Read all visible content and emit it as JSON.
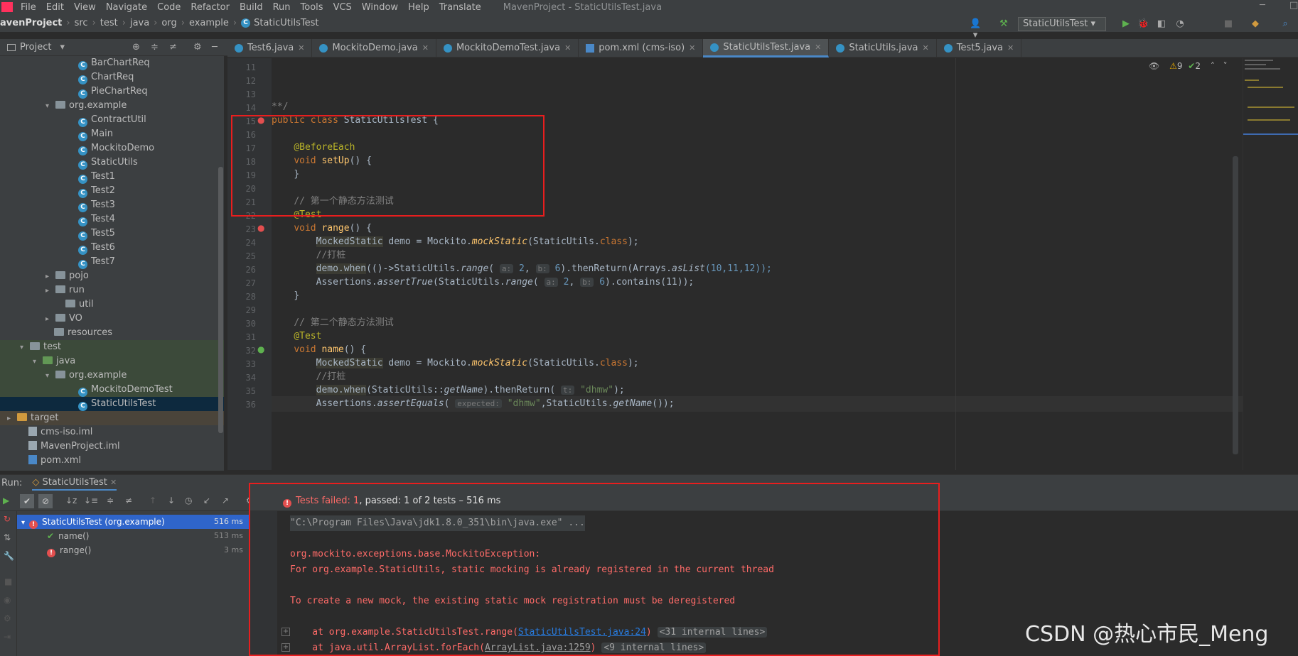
{
  "menu": {
    "items": [
      "File",
      "Edit",
      "View",
      "Navigate",
      "Code",
      "Refactor",
      "Build",
      "Run",
      "Tools",
      "VCS",
      "Window",
      "Help",
      "Translate"
    ],
    "window_title": "MavenProject - StaticUtilsTest.java"
  },
  "breadcrumb": [
    "avenProject",
    "src",
    "test",
    "java",
    "org",
    "example",
    "StaticUtilsTest"
  ],
  "toolbar": {
    "run_config": "StaticUtilsTest"
  },
  "project_panel": {
    "title": "Project"
  },
  "tree": [
    {
      "label": "BarChartReq",
      "indent": 110,
      "icon": "class"
    },
    {
      "label": "ChartReq",
      "indent": 110,
      "icon": "class"
    },
    {
      "label": "PieChartReq",
      "indent": 110,
      "icon": "class"
    },
    {
      "label": "org.example",
      "indent": 78,
      "icon": "package",
      "arrow": "v"
    },
    {
      "label": "ContractUtil",
      "indent": 110,
      "icon": "class"
    },
    {
      "label": "Main",
      "indent": 110,
      "icon": "class"
    },
    {
      "label": "MockitoDemo",
      "indent": 110,
      "icon": "class"
    },
    {
      "label": "StaticUtils",
      "indent": 110,
      "icon": "class"
    },
    {
      "label": "Test1",
      "indent": 110,
      "icon": "class"
    },
    {
      "label": "Test2",
      "indent": 110,
      "icon": "class"
    },
    {
      "label": "Test3",
      "indent": 110,
      "icon": "class"
    },
    {
      "label": "Test4",
      "indent": 110,
      "icon": "class"
    },
    {
      "label": "Test5",
      "indent": 110,
      "icon": "class"
    },
    {
      "label": "Test6",
      "indent": 110,
      "icon": "class"
    },
    {
      "label": "Test7",
      "indent": 110,
      "icon": "class"
    },
    {
      "label": "pojo",
      "indent": 78,
      "icon": "folder",
      "arrow": ">"
    },
    {
      "label": "run",
      "indent": 78,
      "icon": "folder",
      "arrow": ">"
    },
    {
      "label": "util",
      "indent": 92,
      "icon": "folder"
    },
    {
      "label": "VO",
      "indent": 78,
      "icon": "folder",
      "arrow": ">"
    },
    {
      "label": "resources",
      "indent": 76,
      "icon": "folder"
    },
    {
      "label": "test",
      "indent": 42,
      "icon": "folder",
      "arrow": "v"
    },
    {
      "label": "java",
      "indent": 60,
      "icon": "folder-green",
      "arrow": "v"
    },
    {
      "label": "org.example",
      "indent": 78,
      "icon": "package",
      "arrow": "v"
    },
    {
      "label": "MockitoDemoTest",
      "indent": 110,
      "icon": "class"
    },
    {
      "label": "StaticUtilsTest",
      "indent": 110,
      "icon": "class",
      "selected": true
    },
    {
      "label": "target",
      "indent": 24,
      "icon": "folder-orange",
      "arrow": ">"
    },
    {
      "label": "cms-iso.iml",
      "indent": 40,
      "icon": "file"
    },
    {
      "label": "MavenProject.iml",
      "indent": 40,
      "icon": "file"
    },
    {
      "label": "pom.xml",
      "indent": 40,
      "icon": "maven"
    }
  ],
  "tabs": [
    {
      "label": "Test6.java"
    },
    {
      "label": "MockitoDemo.java"
    },
    {
      "label": "MockitoDemoTest.java"
    },
    {
      "label": "pom.xml (cms-iso)"
    },
    {
      "label": "StaticUtilsTest.java",
      "active": true
    },
    {
      "label": "StaticUtils.java"
    },
    {
      "label": "Test5.java"
    }
  ],
  "editor": {
    "inspections": {
      "warnings": "9",
      "ok": "2"
    },
    "line_numbers": [
      "11",
      "12",
      "13",
      "14",
      "15",
      "16",
      "17",
      "18",
      "19",
      "20",
      "21",
      "22",
      "23",
      "24",
      "25",
      "26",
      "27",
      "28",
      "29",
      "30",
      "31",
      "32",
      "33",
      "34",
      "35",
      "36"
    ],
    "comment_end": "**/",
    "class_decl": {
      "kw1": "public",
      "kw2": "class",
      "name": "StaticUtilsTest",
      "brace": "{"
    },
    "before_each": "@BeforeEach",
    "setup": {
      "kw": "void",
      "name": "setUp",
      "rest": "() {"
    },
    "close_brace": "}",
    "comment1": "// 第一个静态方法测试",
    "test_anno": "@Test",
    "range_decl": {
      "kw": "void",
      "name": "range",
      "rest": "() {"
    },
    "mocked_static": "MockedStatic",
    "demo_assign": " demo = Mockito.",
    "mock_static": "mockStatic",
    "static_utils_class": "(StaticUtils.",
    "class_kw": "class",
    "end_paren": ");",
    "stub_comment": "//打桩",
    "demo_when": "demo.when",
    "lambda": "(()->StaticUtils.",
    "range_fn": "range",
    "hint_a": "a:",
    "hint_b": "b:",
    "val2": "2",
    "val6": "6",
    "then_return": ").thenReturn(Arrays.",
    "as_list": "asList",
    "list_vals": "(10,11,12));",
    "assertions": "Assertions.",
    "assert_true": "assertTrue",
    "static_utils_dot": "(StaticUtils.",
    "contains": ").contains(11));",
    "comment2": "// 第二个静态方法测试",
    "name_decl": {
      "kw": "void",
      "name": "name",
      "rest": "() {"
    },
    "when_ref": "(StaticUtils::",
    "get_name": "getName",
    "then_return2": ").thenReturn(",
    "hint_t": "t:",
    "dhmw": "\"dhmw\"",
    "assert_equals": "assertEquals",
    "hint_expected": "expected:",
    "get_name_call": ",StaticUtils.",
    "get_name_end": "());"
  },
  "run_panel": {
    "label": "Run:",
    "tab": "StaticUtilsTest",
    "status_failed": "Tests failed: 1",
    "status_rest": ", passed: 1 of 2 tests – 516 ms",
    "tests": [
      {
        "name": "StaticUtilsTest (org.example)",
        "ms": "516 ms",
        "status": "fail",
        "selected": true
      },
      {
        "name": "name()",
        "ms": "513 ms",
        "status": "pass"
      },
      {
        "name": "range()",
        "ms": "3 ms",
        "status": "fail"
      }
    ]
  },
  "console": {
    "cmd": "\"C:\\Program Files\\Java\\jdk1.8.0_351\\bin\\java.exe\" ...",
    "exception": "org.mockito.exceptions.base.MockitoException:",
    "msg1": "For org.example.StaticUtils, static mocking is already registered in the current thread",
    "msg2": "To create a new mock, the existing static mock registration must be deregistered",
    "trace1_prefix": "    at org.example.StaticUtilsTest.range(",
    "trace1_link": "StaticUtilsTest.java:24",
    "trace1_suffix": ")",
    "trace1_internal": "<31 internal lines>",
    "trace2_prefix": "    at java.util.ArrayList.forEach(",
    "trace2_link": "ArrayList.java:1259",
    "trace2_suffix": ")",
    "trace2_internal": "<9 internal lines>"
  },
  "watermark": "CSDN @热心市民_Meng"
}
